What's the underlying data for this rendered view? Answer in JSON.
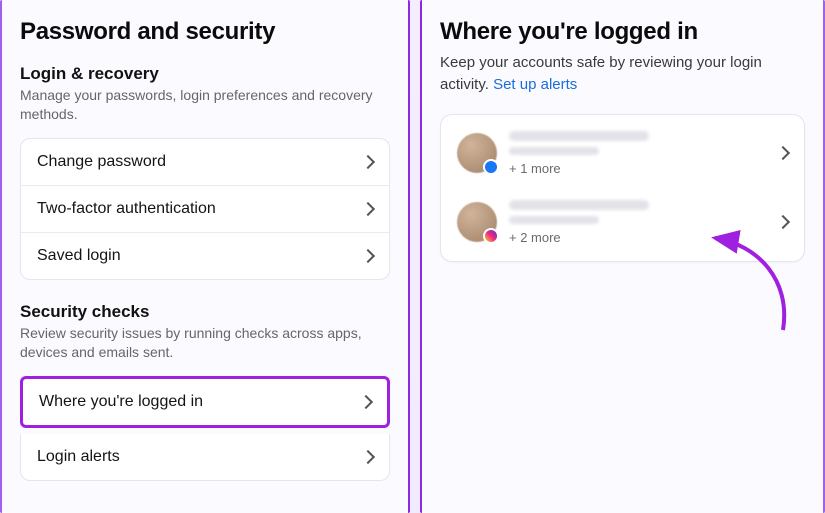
{
  "colors": {
    "highlight": "#a020e0",
    "link": "#1a6ed8"
  },
  "left": {
    "title": "Password and security",
    "login_recovery": {
      "heading": "Login & recovery",
      "desc": "Manage your passwords, login preferences and recovery methods.",
      "items": [
        {
          "label": "Change password"
        },
        {
          "label": "Two-factor authentication"
        },
        {
          "label": "Saved login"
        }
      ]
    },
    "security_checks": {
      "heading": "Security checks",
      "desc": "Review security issues by running checks across apps, devices and emails sent.",
      "items": [
        {
          "label": "Where you're logged in",
          "highlighted": true
        },
        {
          "label": "Login alerts"
        }
      ]
    }
  },
  "right": {
    "title": "Where you're logged in",
    "desc_prefix": "Keep your accounts safe by reviewing your login activity. ",
    "link_text": "Set up alerts",
    "sessions": [
      {
        "platform": "facebook",
        "more_label": "+ 1 more"
      },
      {
        "platform": "instagram",
        "more_label": "+ 2 more"
      }
    ]
  }
}
